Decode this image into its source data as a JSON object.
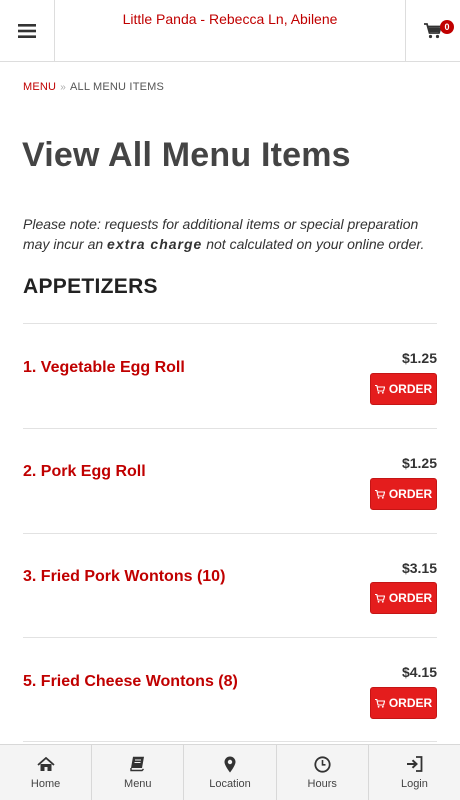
{
  "header": {
    "title": "Little Panda - Rebecca Ln, Abilene",
    "cart_count": "0"
  },
  "breadcrumb": {
    "menu": "MENU",
    "separator": "»",
    "current": "ALL MENU ITEMS"
  },
  "page_title": "View All Menu Items",
  "note": {
    "part1": "Please note: requests for additional items or special preparation may incur an ",
    "emphasis": "extra charge",
    "part2": " not calculated on your online order."
  },
  "section": {
    "heading": "APPETIZERS",
    "items": [
      {
        "name": "1. Vegetable Egg Roll",
        "price": "$1.25",
        "button": "ORDER"
      },
      {
        "name": "2. Pork Egg Roll",
        "price": "$1.25",
        "button": "ORDER"
      },
      {
        "name": "3. Fried Pork Wontons (10)",
        "price": "$3.15",
        "button": "ORDER"
      },
      {
        "name": "5. Fried Cheese Wontons (8)",
        "price": "$4.15",
        "button": "ORDER"
      }
    ]
  },
  "bottom_nav": [
    {
      "label": "Home",
      "icon": "home-icon"
    },
    {
      "label": "Menu",
      "icon": "book-icon"
    },
    {
      "label": "Location",
      "icon": "map-marker-icon"
    },
    {
      "label": "Hours",
      "icon": "clock-icon"
    },
    {
      "label": "Login",
      "icon": "sign-in-icon"
    }
  ],
  "colors": {
    "brand_red": "#c00000",
    "button_red": "#e41d1d"
  }
}
